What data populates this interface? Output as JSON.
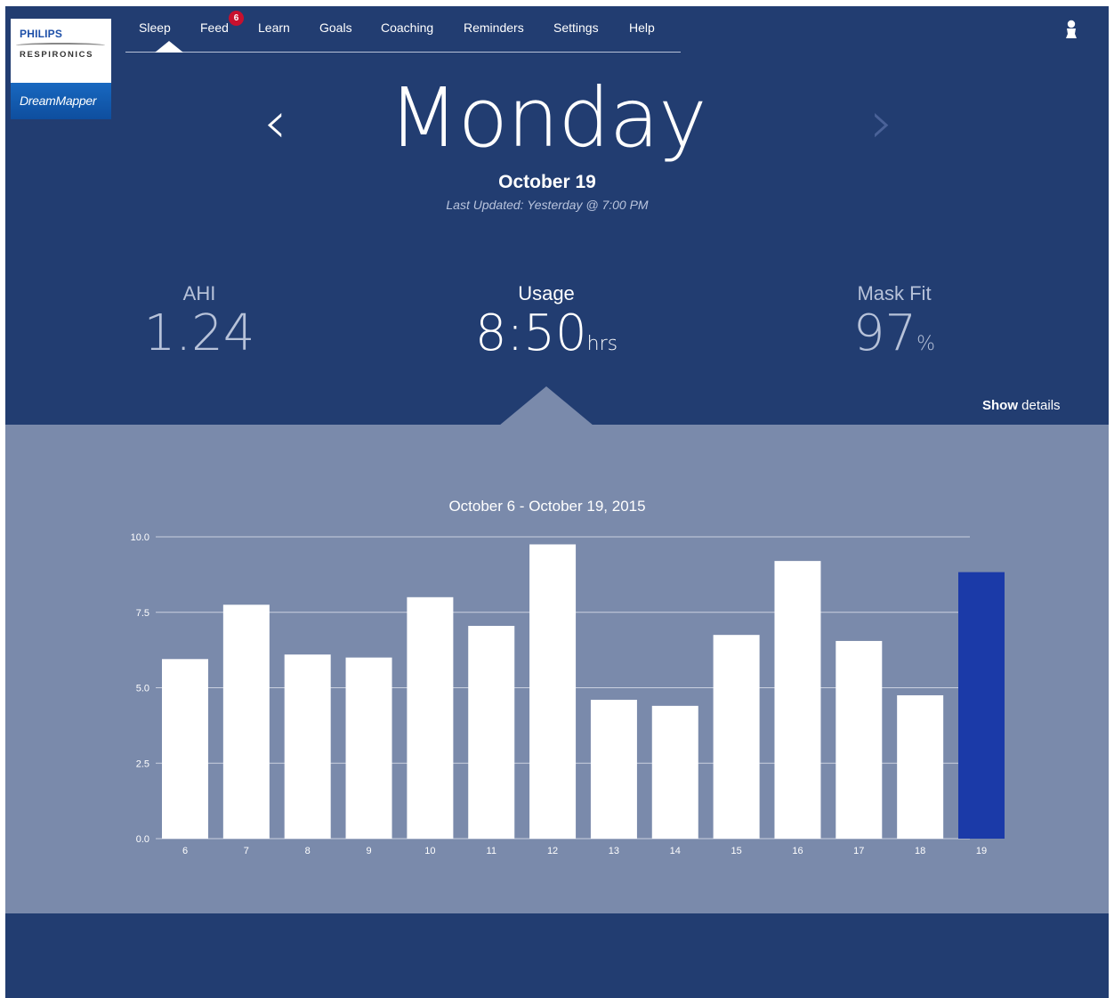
{
  "logo": {
    "brand": "PHILIPS",
    "sub": "RESPIRONICS",
    "product": "DreamMapper"
  },
  "nav": {
    "items": [
      {
        "label": "Sleep",
        "active": true
      },
      {
        "label": "Feed",
        "badge": "6"
      },
      {
        "label": "Learn"
      },
      {
        "label": "Goals"
      },
      {
        "label": "Coaching"
      },
      {
        "label": "Reminders"
      },
      {
        "label": "Settings"
      },
      {
        "label": "Help"
      }
    ],
    "user_icon": "user-icon"
  },
  "day": {
    "name": "Monday",
    "date": "October 19",
    "last_updated": "Last Updated: Yesterday @ 7:00 PM",
    "prev_icon": "chevron-left-icon",
    "next_icon": "chevron-right-icon"
  },
  "stats": {
    "ahi": {
      "label": "AHI",
      "value": "1.24"
    },
    "usage": {
      "label": "Usage",
      "value": "8:50",
      "unit": "hrs"
    },
    "mask_fit": {
      "label": "Mask Fit",
      "value": "97",
      "unit": "%"
    }
  },
  "show_details": {
    "bold": "Show",
    "rest": "details"
  },
  "colors": {
    "background": "#223d71",
    "panel": "#7a8aab",
    "bar": "#ffffff",
    "bar_selected": "#1b3aa8"
  },
  "chart_data": {
    "type": "bar",
    "title": "October 6 - October 19, 2015",
    "categories": [
      "6",
      "7",
      "8",
      "9",
      "10",
      "11",
      "12",
      "13",
      "14",
      "15",
      "16",
      "17",
      "18",
      "19"
    ],
    "values": [
      5.95,
      7.75,
      6.1,
      6.0,
      8.0,
      7.05,
      9.75,
      4.6,
      4.4,
      6.75,
      9.2,
      6.55,
      4.75,
      8.83
    ],
    "selected_category": "19",
    "ylim": [
      0,
      10
    ],
    "yticks": [
      "0.0",
      "2.5",
      "5.0",
      "7.5",
      "10.0"
    ],
    "grid": true,
    "xlabel": "",
    "ylabel": ""
  }
}
